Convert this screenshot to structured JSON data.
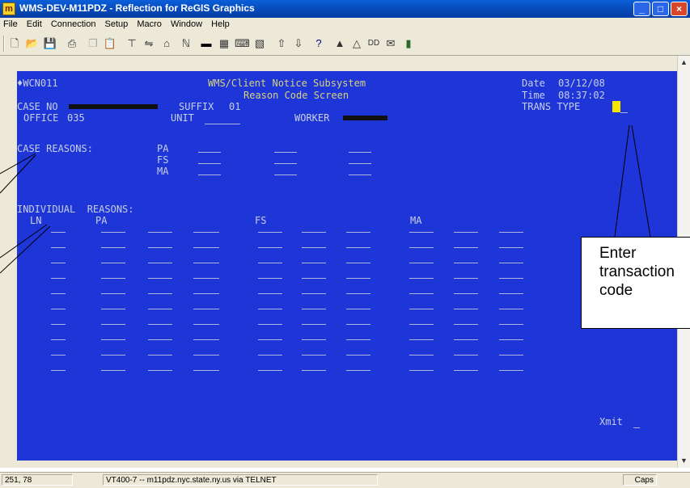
{
  "window": {
    "app_icon": "reflection-app-icon",
    "title": "WMS-DEV-M11PDZ - Reflection for ReGIS Graphics",
    "buttons": [
      "minimize-icon",
      "maximize-icon",
      "close-icon"
    ]
  },
  "menu": [
    "File",
    "Edit",
    "Connection",
    "Setup",
    "Macro",
    "Window",
    "Help"
  ],
  "toolbar_icons": [
    "new-icon",
    "open-icon",
    "save-icon",
    "print-icon",
    "copy-icon",
    "paste-icon",
    "connect-icon",
    "transfer-icon",
    "host-icon",
    "edit-icon",
    "display-icon",
    "terminal-icon",
    "keyboard-icon",
    "color-icon",
    "send-icon",
    "receive-icon",
    "help-icon",
    "macro-record-icon",
    "macro-run-icon",
    "hotspot-icon",
    "mail-icon",
    "book-icon"
  ],
  "terminal": {
    "screen_id": "♦WCN011",
    "system_title": "WMS/Client Notice Subsystem",
    "screen_title": "Reason Code Screen",
    "date_label": "Date",
    "date_value": "03/12/08",
    "time_label": "Time",
    "time_value": "08:37:02",
    "case_no_label": "CASE NO",
    "suffix_label": "SUFFIX",
    "suffix_value": "01",
    "trans_type_label": "TRANS TYPE",
    "office_label": "OFFICE",
    "office_value": "035",
    "unit_label": "UNIT",
    "worker_label": "WORKER",
    "case_reasons_label": "CASE REASONS:",
    "case_reason_programs": [
      "PA",
      "FS",
      "MA"
    ],
    "individual_reasons_label": "INDIVIDUAL  REASONS:",
    "individual_columns": [
      "LN",
      "PA",
      "FS",
      "MA"
    ],
    "individual_rows": 10,
    "xmit_label": "Xmit"
  },
  "callout": {
    "lines": [
      "Enter",
      "transaction",
      "code"
    ]
  },
  "status": {
    "cursor_position": "251, 78",
    "connection": "VT400-7 -- m11pdz.nyc.state.ny.us via TELNET",
    "caps": "Caps"
  },
  "colors": {
    "terminal_bg": "#1e35d8",
    "terminal_text": "#c7cfe8",
    "title_text": "#d7d27e",
    "cursor": "#f4e400",
    "titlebar": "#0747b6"
  }
}
